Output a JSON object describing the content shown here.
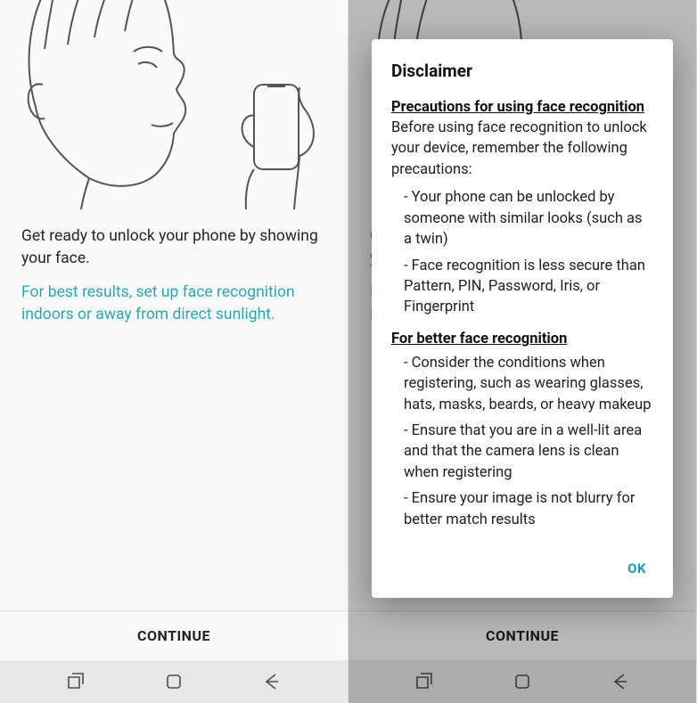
{
  "left": {
    "main_text": "Get ready to unlock your phone by showing your face.",
    "tip_text": "For best results, set up face recognition indoors or away from direct sunlight.",
    "continue_label": "CONTINUE"
  },
  "right": {
    "main_text": "Get ready to unlock your phone by showing your face.",
    "tip_text": "For best results, set up face recognition indoors or away from direct sunlight.",
    "continue_label": "CONTINUE",
    "dialog": {
      "title": "Disclaimer",
      "section1_heading": "Precautions for using face recognition",
      "section1_intro": "Before using face recognition to unlock your device, remember the following precautions:",
      "section1_bullets": [
        "- Your phone can be unlocked by someone with similar looks (such as a twin)",
        "- Face recognition is less secure than Pattern, PIN, Password, Iris, or Fingerprint"
      ],
      "section2_heading": "For better face recognition",
      "section2_bullets": [
        "- Consider the conditions when registering, such as wearing glasses, hats, masks, beards, or heavy makeup",
        "- Ensure that you are in a well-lit area and that the camera lens is clean when registering",
        "- Ensure your image is not blurry for better match results"
      ],
      "ok_label": "OK"
    }
  }
}
